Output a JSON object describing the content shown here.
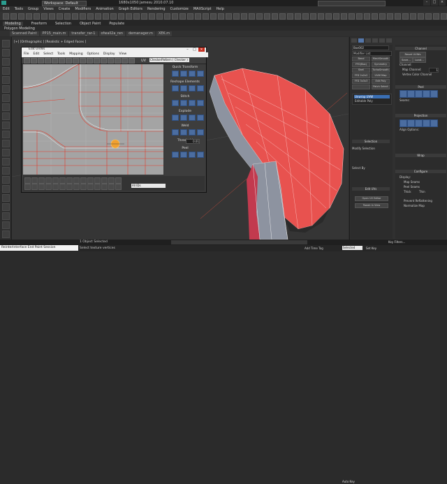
{
  "app": {
    "workspace": "Workspace: Default",
    "title": "1680x1050   Jamesu 2010.07.10"
  },
  "menubar": [
    "Edit",
    "Tools",
    "Group",
    "Views",
    "Create",
    "Modifiers",
    "Animation",
    "Graph Editors",
    "Rendering",
    "Customize",
    "MAXScript",
    "Help"
  ],
  "ribbon": {
    "tabs": [
      "Modeling",
      "Freeform",
      "Selection",
      "Object Paint",
      "Populate"
    ],
    "subtitle": "Polygon Modeling"
  },
  "doc_tabs": [
    "Scanned Paint",
    "PP15_main.m",
    "transfer_rar-1",
    "ofwall2a_ren",
    "demanager.m",
    "XEK.m"
  ],
  "viewport": {
    "label": "[+] [Orthographic ] [Realistic + Edged Faces ]"
  },
  "uvw_editor": {
    "title": "Edit UVWs",
    "menu": [
      "File",
      "Edit",
      "Select",
      "Tools",
      "Mapping",
      "Options",
      "Display",
      "View"
    ],
    "uv_label": "UV",
    "texture_select": "CheckerPattern ( Checker )",
    "zoom_select": "All IDs",
    "side_sections": [
      "Quick Transform",
      "Reshape Elements",
      "Stitch",
      "Explode",
      "Weld",
      "Threshold",
      "Peel"
    ],
    "weld_threshold": "0.01"
  },
  "command_panel": {
    "object_name": "Box002",
    "modifier_list": "Modifier List",
    "modifiers": [
      "Bend",
      "MeshSmooth",
      "FFD(Box)",
      "Symmetry",
      "Shell",
      "TurboSmooth",
      "FFD 2x2x2",
      "UVW Map",
      "FFD 3x3x3",
      "Edit Poly",
      "",
      "Patch Select"
    ],
    "stack": [
      "Unwrap UVW",
      "Editable Poly"
    ],
    "selection_header": "Selection",
    "modify_selection": "Modify Selection",
    "select_by": "Select By",
    "edit_uvs_header": "Edit UVs",
    "open_uv_editor": "Open UV Editor",
    "tweak_in_view": "Tweak In View"
  },
  "right_panel": {
    "channel_header": "Channel",
    "reset_uvws": "Reset UVWs",
    "save": "Save...",
    "load": "Load...",
    "channel_label": "Channel:",
    "map_channel": "Map Channel:",
    "map_channel_value": "1",
    "vertex_color_channel": "Vertex Color Channel",
    "peel_header": "Peel",
    "seams_label": "Seams:",
    "projection_header": "Projection",
    "align_options": "Align Options:",
    "wrap_header": "Wrap",
    "configure_header": "Configure",
    "display_label": "Display:",
    "map_seams": "Map Seams",
    "peel_seams": "Peel Seams",
    "thick": "Thick",
    "thin": "Thin",
    "prevent_reflattening": "Prevent Reflattening",
    "normalize_map": "Normalize Map"
  },
  "statusbar": {
    "object_selected": "1 Object Selected",
    "prompt": "Select texture vertices",
    "maxscript": "ReinterInterface End Paint Session",
    "auto_key": "Auto Key",
    "selected": "Selected",
    "set_key": "Set Key",
    "key_filters": "Key Filters...",
    "add_time_tag": "Add Time Tag"
  },
  "colors": {
    "mesh_red": "#e8524f",
    "mesh_gray": "#9aa0ab",
    "uv_lines": "#e23b2b",
    "gizmo": "#f0a030",
    "panel_bg": "#2b2b2b"
  }
}
